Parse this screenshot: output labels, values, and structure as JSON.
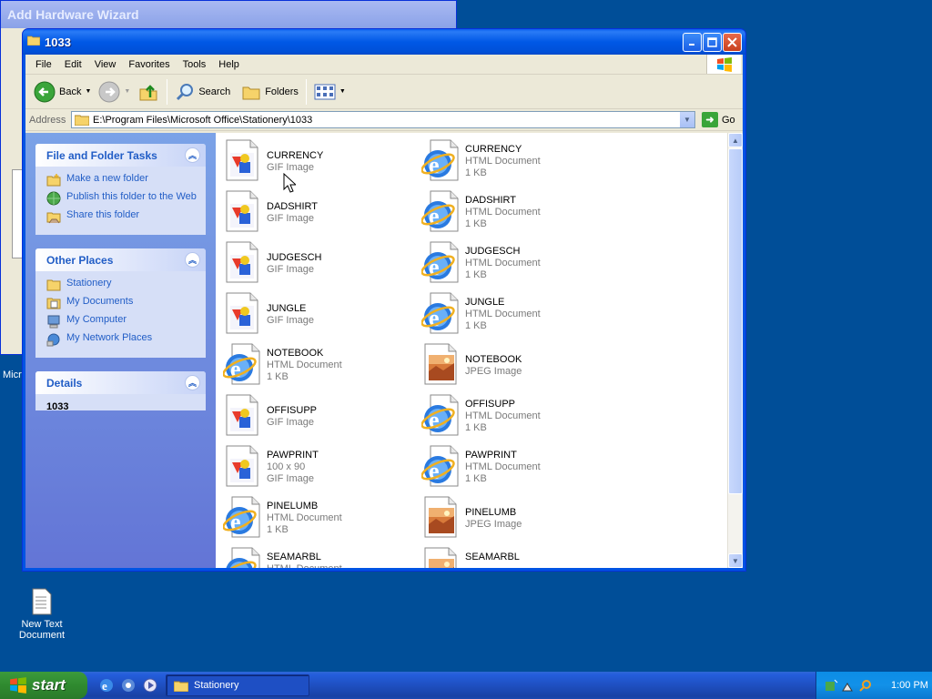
{
  "wizard": {
    "title": "Add Hardware Wizard"
  },
  "desktop_fragment": "Micr",
  "window": {
    "title": "1033",
    "menu": [
      "File",
      "Edit",
      "View",
      "Favorites",
      "Tools",
      "Help"
    ],
    "toolbar": {
      "back": "Back",
      "search": "Search",
      "folders": "Folders"
    },
    "address": {
      "label": "Address",
      "value": "E:\\Program Files\\Microsoft Office\\Stationery\\1033",
      "go": "Go"
    }
  },
  "taskpane": {
    "file_tasks": {
      "title": "File and Folder Tasks",
      "items": [
        "Make a new folder",
        "Publish this folder to the Web",
        "Share this folder"
      ]
    },
    "other_places": {
      "title": "Other Places",
      "items": [
        "Stationery",
        "My Documents",
        "My Computer",
        "My Network Places"
      ]
    },
    "details": {
      "title": "Details",
      "name": "1033"
    }
  },
  "files": [
    {
      "name": "CURRENCY",
      "lines": [
        "GIF Image"
      ],
      "icon": "gif"
    },
    {
      "name": "CURRENCY",
      "lines": [
        "HTML Document",
        "1 KB"
      ],
      "icon": "html"
    },
    {
      "name": "DADSHIRT",
      "lines": [
        "GIF Image"
      ],
      "icon": "gif"
    },
    {
      "name": "DADSHIRT",
      "lines": [
        "HTML Document",
        "1 KB"
      ],
      "icon": "html"
    },
    {
      "name": "JUDGESCH",
      "lines": [
        "GIF Image"
      ],
      "icon": "gif"
    },
    {
      "name": "JUDGESCH",
      "lines": [
        "HTML Document",
        "1 KB"
      ],
      "icon": "html"
    },
    {
      "name": "JUNGLE",
      "lines": [
        "GIF Image"
      ],
      "icon": "gif"
    },
    {
      "name": "JUNGLE",
      "lines": [
        "HTML Document",
        "1 KB"
      ],
      "icon": "html"
    },
    {
      "name": "NOTEBOOK",
      "lines": [
        "HTML Document",
        "1 KB"
      ],
      "icon": "html"
    },
    {
      "name": "NOTEBOOK",
      "lines": [
        "JPEG Image"
      ],
      "icon": "jpeg"
    },
    {
      "name": "OFFISUPP",
      "lines": [
        "GIF Image"
      ],
      "icon": "gif"
    },
    {
      "name": "OFFISUPP",
      "lines": [
        "HTML Document",
        "1 KB"
      ],
      "icon": "html"
    },
    {
      "name": "PAWPRINT",
      "lines": [
        "100 x 90",
        "GIF Image"
      ],
      "icon": "gif"
    },
    {
      "name": "PAWPRINT",
      "lines": [
        "HTML Document",
        "1 KB"
      ],
      "icon": "html"
    },
    {
      "name": "PINELUMB",
      "lines": [
        "HTML Document",
        "1 KB"
      ],
      "icon": "html"
    },
    {
      "name": "PINELUMB",
      "lines": [
        "JPEG Image"
      ],
      "icon": "jpeg"
    },
    {
      "name": "SEAMARBL",
      "lines": [
        "HTML Document"
      ],
      "icon": "html"
    },
    {
      "name": "SEAMARBL",
      "lines": [],
      "icon": "jpeg"
    }
  ],
  "desktop_icon": {
    "label": "New Text Document"
  },
  "taskbar": {
    "start": "start",
    "task": "Stationery",
    "clock": "1:00 PM"
  }
}
